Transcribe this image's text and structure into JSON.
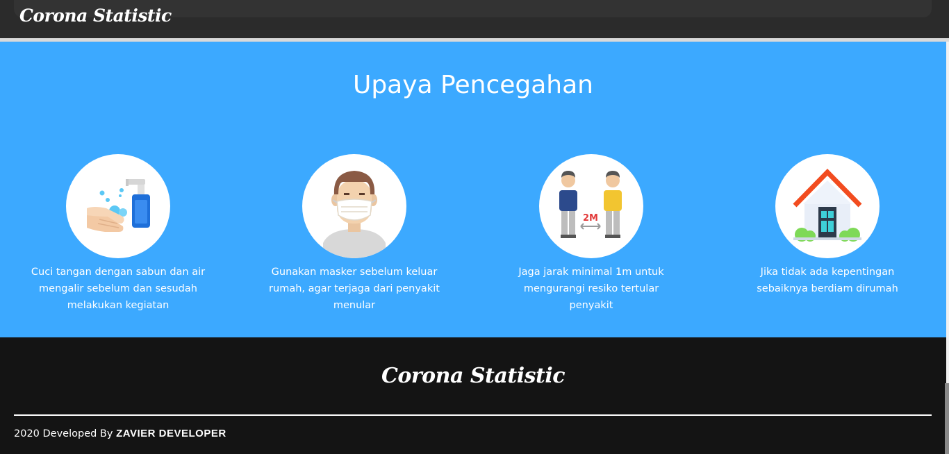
{
  "navbar": {
    "brand": "Corona Statistic"
  },
  "prevention": {
    "title": "Upaya Pencegahan",
    "items": [
      {
        "icon": "hand-wash-sanitizer-icon",
        "text": "Cuci tangan dengan sabun dan air mengalir sebelum dan sesudah melakukan kegiatan"
      },
      {
        "icon": "face-mask-icon",
        "text": "Gunakan masker sebelum keluar rumah, agar terjaga dari penyakit menular"
      },
      {
        "icon": "social-distance-icon",
        "label": "2M",
        "text": "Jaga jarak minimal 1m untuk mengurangi resiko tertular penyakit"
      },
      {
        "icon": "stay-home-icon",
        "text": "Jika tidak ada kepentingan sebaiknya berdiam dirumah"
      }
    ]
  },
  "footer": {
    "brand": "Corona Statistic",
    "credit_prefix": "2020 Developed By",
    "credit_name": "ZAVIER DEVELOPER"
  },
  "colors": {
    "section_bg": "#3ca9ff",
    "footer_bg": "#141414",
    "navbar_bg": "#2b2b2b"
  }
}
